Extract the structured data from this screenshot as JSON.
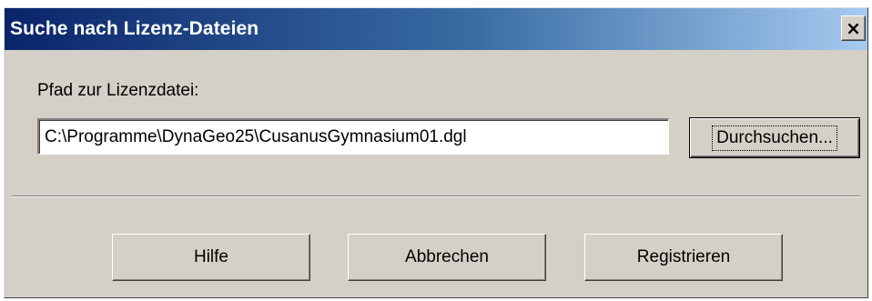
{
  "window": {
    "title": "Suche nach Lizenz-Dateien",
    "close_glyph": "×"
  },
  "form": {
    "path_label": "Pfad zur Lizenzdatei:",
    "path_value": "C:\\Programme\\DynaGeo25\\CusanusGymnasium01.dgl",
    "browse_label": "Durchsuchen..."
  },
  "buttons": {
    "help": "Hilfe",
    "cancel": "Abbrechen",
    "register": "Registrieren"
  },
  "colors": {
    "titlebar_start": "#0a246a",
    "titlebar_end": "#a6caf0",
    "dialog_bg": "#d4d0c8"
  },
  "icons": {
    "close": "close-icon"
  }
}
